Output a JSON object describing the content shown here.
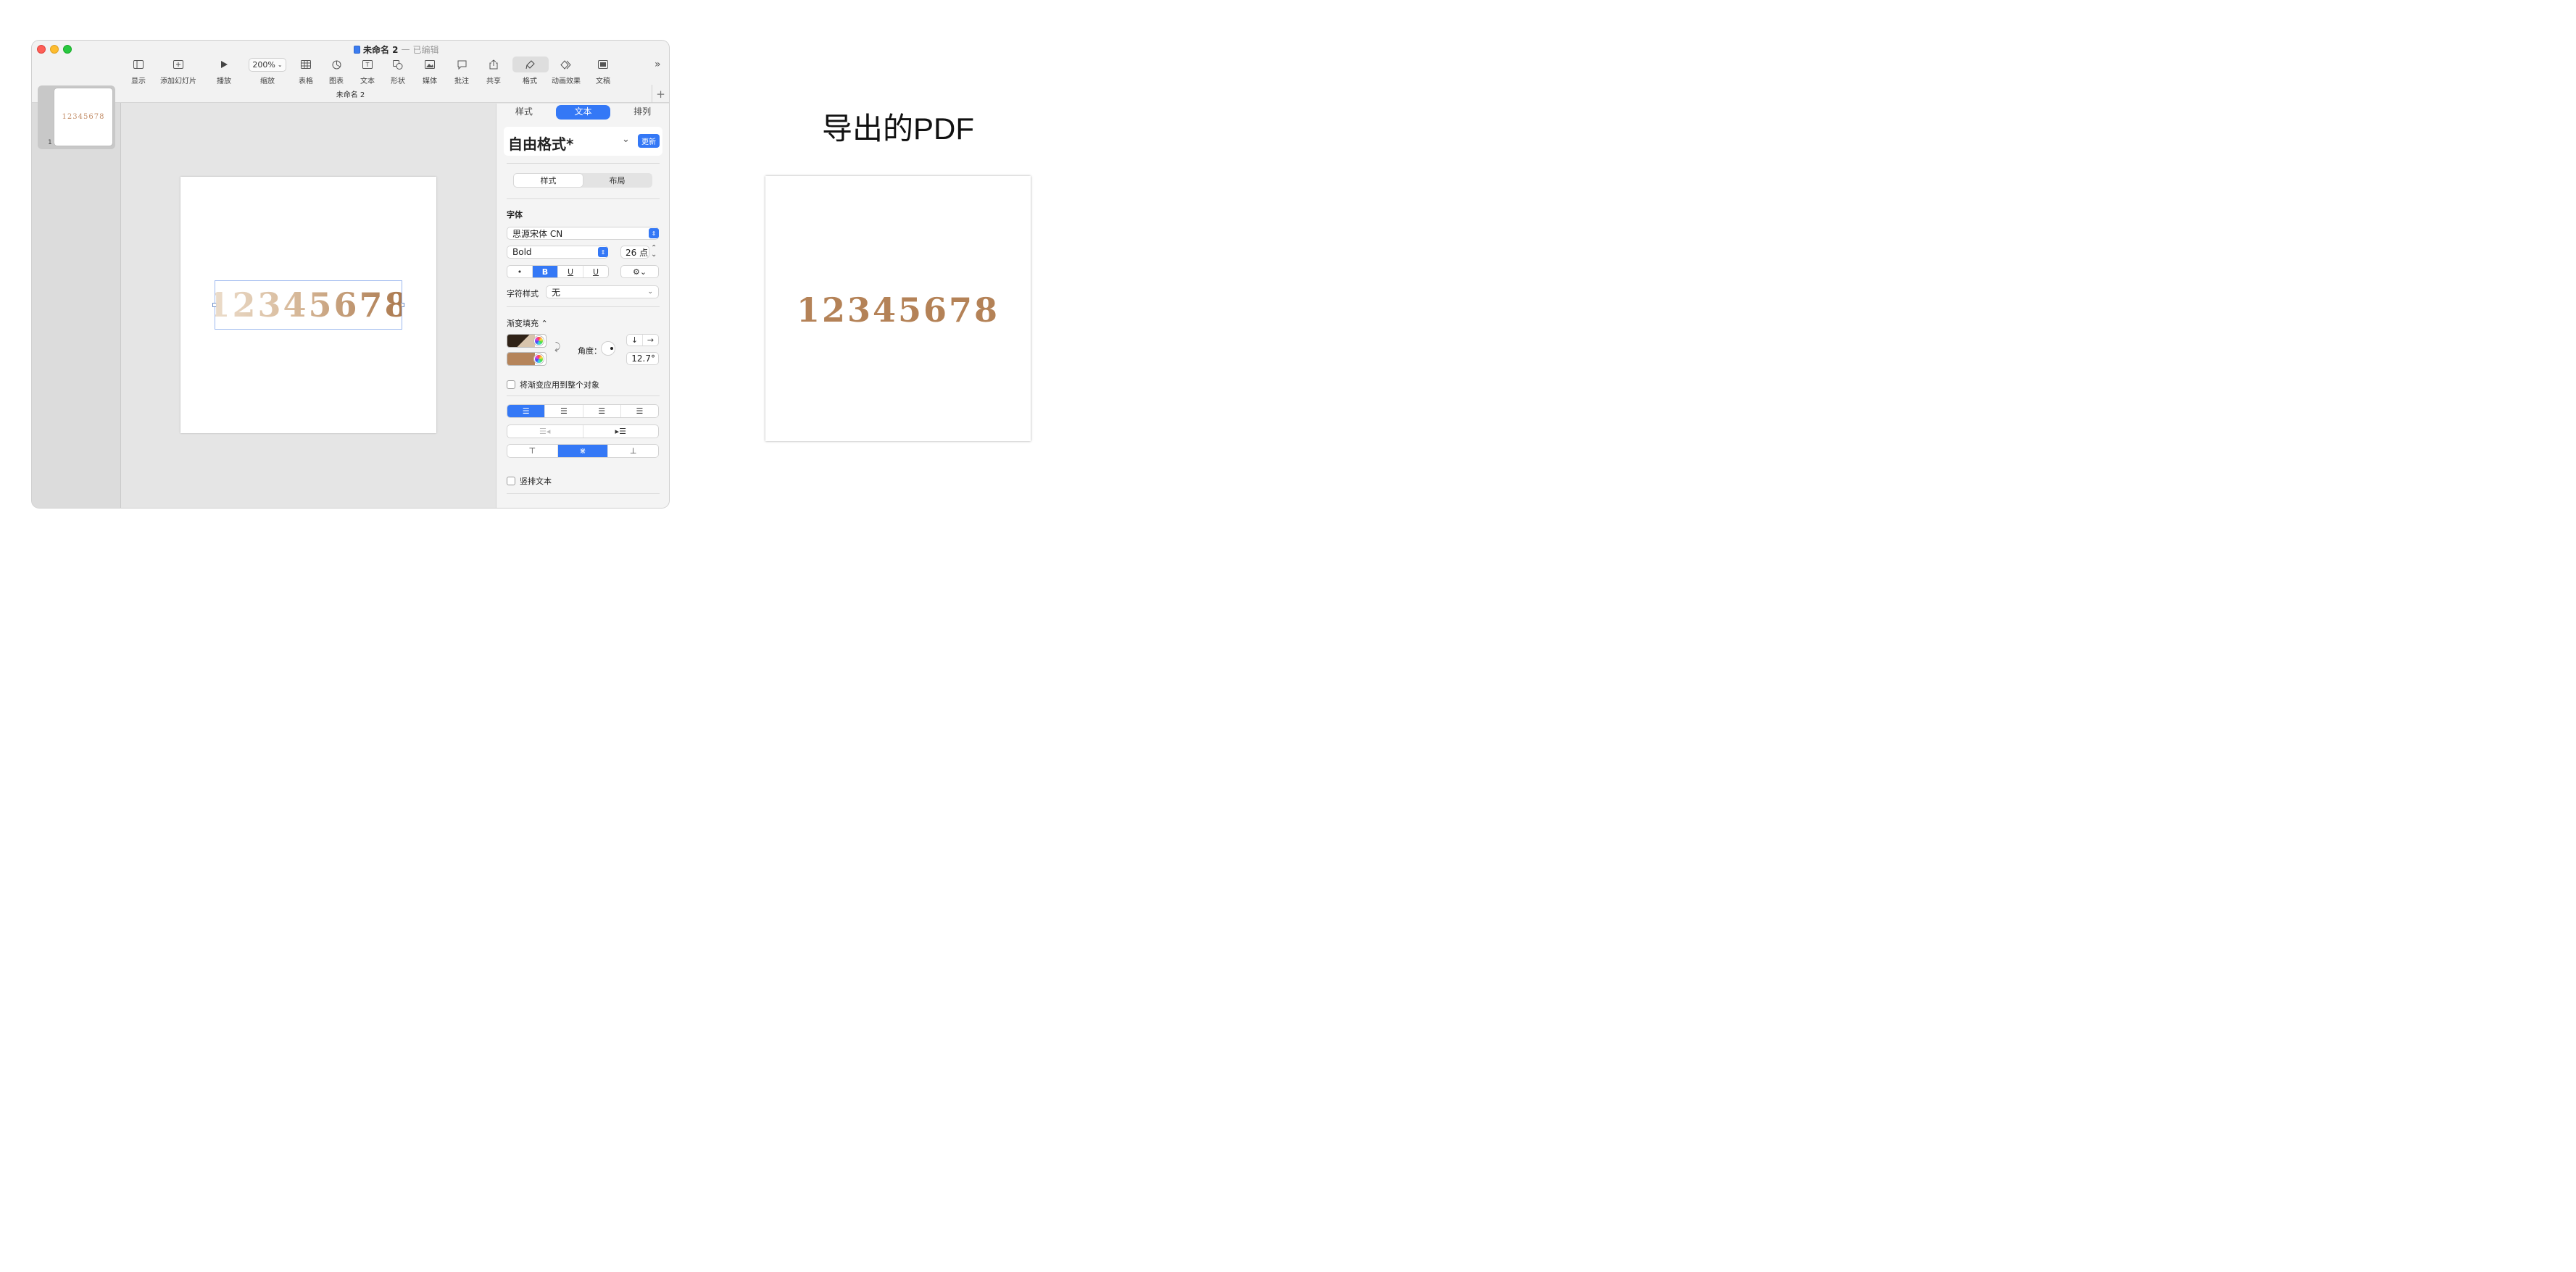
{
  "window": {
    "doc_name": "未命名 2",
    "separator": "—",
    "edited_label": "已编辑",
    "tab_name": "未命名 2"
  },
  "toolbar": {
    "view": "显示",
    "add_slide": "添加幻灯片",
    "play": "播放",
    "zoom_value": "200%",
    "zoom": "缩放",
    "table": "表格",
    "chart": "图表",
    "text": "文本",
    "shape": "形状",
    "media": "媒体",
    "comment": "批注",
    "share": "共享",
    "format": "格式",
    "animate": "动画效果",
    "document": "文稿",
    "more": "»"
  },
  "navigator": {
    "slide_number": "1",
    "thumb_text": "12345678"
  },
  "slide": {
    "text": "12345678"
  },
  "inspector": {
    "tabs": [
      "样式",
      "文本",
      "排列"
    ],
    "active_tab": "文本",
    "paragraph_style": "自由格式*",
    "update_button": "更新",
    "sub_tabs": [
      "样式",
      "布局"
    ],
    "font_section": "字体",
    "font_family": "思源宋体 CN",
    "font_weight": "Bold",
    "font_size": "26 点",
    "style_buttons": [
      "•",
      "B",
      "U",
      "U"
    ],
    "char_style_label": "字符样式",
    "char_style_value": "无",
    "fill_label": "渐变填充 ⌃",
    "angle_label": "角度：",
    "angle_value": "12.7°",
    "apply_whole": "将渐变应用到整个对象",
    "vertical_text": "竖排文本",
    "gradient_colors": [
      "#3a2a1c",
      "#b5845a"
    ]
  },
  "export": {
    "heading": "导出的PDF",
    "text": "12345678",
    "color": "#b48257"
  }
}
